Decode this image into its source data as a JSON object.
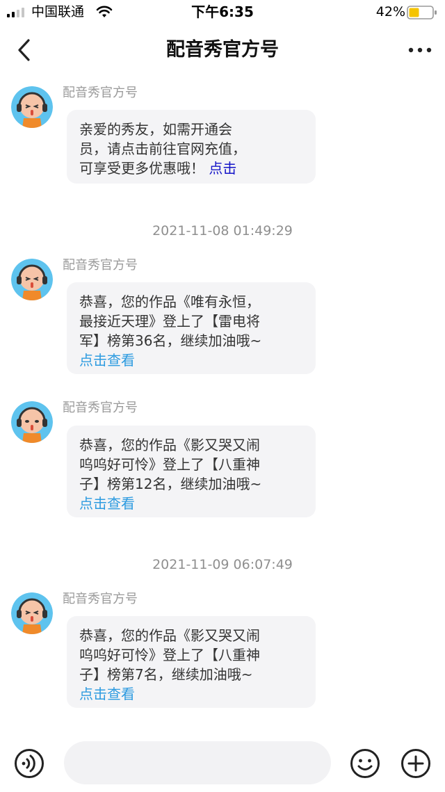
{
  "status_bar": {
    "carrier": "中国联通",
    "time": "下午6:35",
    "battery": "42%",
    "signal_icon": "signal-bars-icon",
    "wifi_icon": "wifi-icon",
    "battery_icon": "battery-icon"
  },
  "nav": {
    "title": "配音秀官方号",
    "back_icon": "chevron-left-icon",
    "more_icon": "more-dots-icon"
  },
  "messages": [
    {
      "sender": "配音秀官方号",
      "lines": [
        "亲爱的秀友，如需开通会",
        "员，请点击前往官网充值，"
      ],
      "last_line_text": "可享受更多优惠哦！",
      "link": "点击"
    },
    {
      "timestamp": "2021-11-08 01:49:29",
      "sender": "配音秀官方号",
      "lines": [
        "恭喜，您的作品《唯有永恒，",
        "最接近天理》登上了【雷电将",
        "军】榜第36名，继续加油哦~"
      ],
      "link": "点击查看"
    },
    {
      "sender": "配音秀官方号",
      "lines": [
        "恭喜，您的作品《影又哭又闹",
        "呜呜好可怜》登上了【八重神",
        "子】榜第12名，继续加油哦~"
      ],
      "link": "点击查看"
    },
    {
      "timestamp": "2021-11-09 06:07:49",
      "sender": "配音秀官方号",
      "lines": [
        "恭喜，您的作品《影又哭又闹",
        "呜呜好可怜》登上了【八重神",
        "子】榜第7名，继续加油哦~"
      ],
      "link": "点击查看"
    }
  ],
  "input": {
    "placeholder": "",
    "voice_icon": "voice-icon",
    "emoji_icon": "emoji-icon",
    "plus_icon": "plus-circle-icon"
  },
  "colors": {
    "link_dark": "#1414c8",
    "link_light": "#2d9be0",
    "bubble_bg": "#f4f4f6",
    "battery_fill": "#f5c400"
  }
}
